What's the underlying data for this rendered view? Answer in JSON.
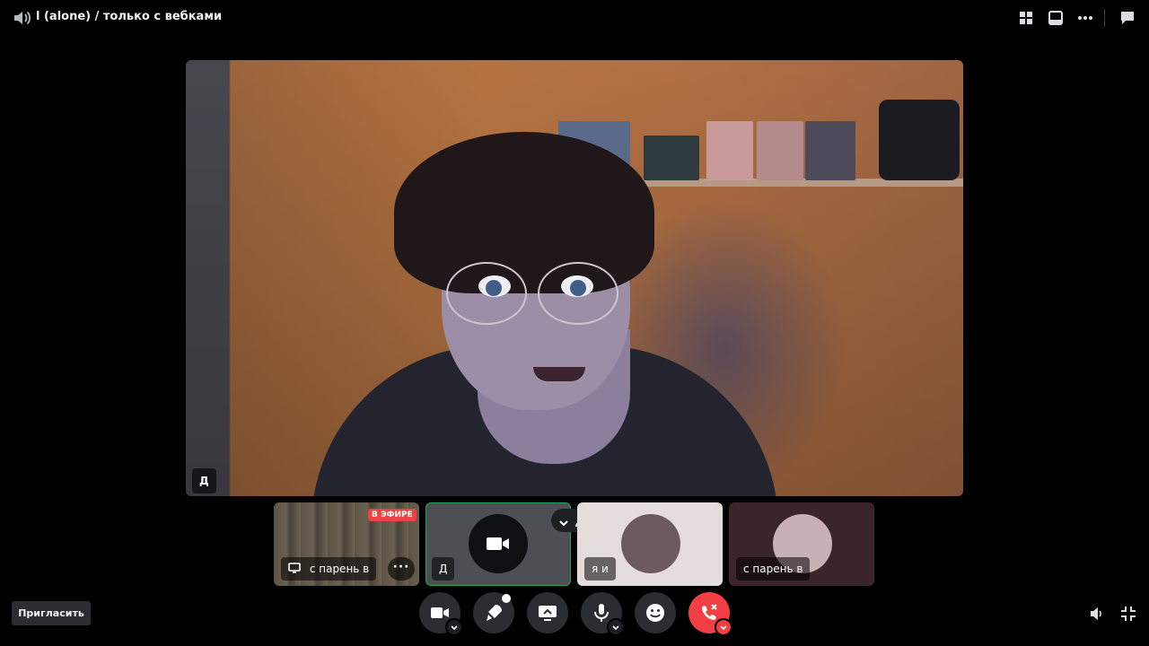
{
  "header": {
    "channel_title": "l (alone) / только с вебками",
    "icons": [
      "speaker-muted-icon",
      "grid-layout-icon",
      "popout-window-icon",
      "more-options-icon",
      "chat-icon"
    ]
  },
  "main_stage": {
    "participant_tag": "Д"
  },
  "tiles": [
    {
      "name": "с парень в",
      "badge": "В ЭФИРЕ",
      "icon": "screen-share-icon"
    },
    {
      "name": "Д",
      "icon": "camera-icon"
    },
    {
      "name": "я и"
    },
    {
      "name": "с парень в"
    }
  ],
  "controls": {
    "invite_label": "Пригласить",
    "buttons": [
      "camera",
      "activities",
      "screen-share",
      "microphone",
      "reactions",
      "disconnect"
    ]
  },
  "colors": {
    "accent_green": "#23a55a",
    "live_red": "#ed4245",
    "end_call_red": "#f23f43"
  }
}
